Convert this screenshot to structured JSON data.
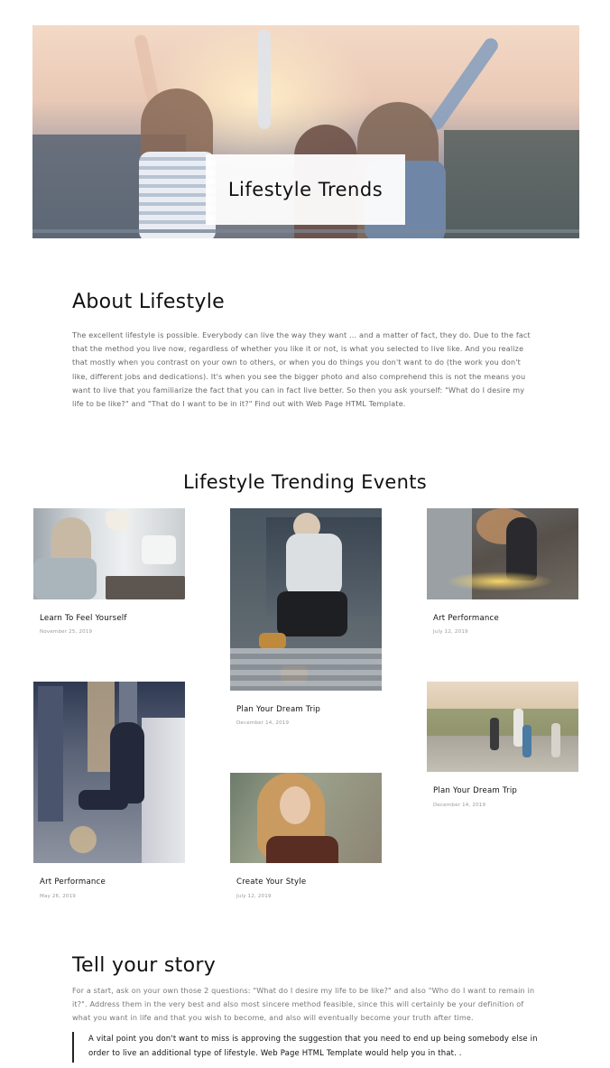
{
  "hero": {
    "title": "Lifestyle Trends"
  },
  "about": {
    "heading": "About Lifestyle",
    "body": "The excellent lifestyle is possible. Everybody can live the way they want ... and a matter of fact, they do. Due to the fact that the method you live now, regardless of whether you like it or not, is what you selected to live like. And you realize that mostly when you contrast on your own to others, or when you do things you don't want to do (the work you don't like, different jobs and dedications). It's when you see the bigger photo and also comprehend this is not the means you want to live that you familiarize the fact that you can in fact live better. So then you ask yourself: \"What do I desire my life to be like?\" and \"That do I want to be in it?\" Find out with Web Page HTML Template."
  },
  "events": {
    "heading": "Lifestyle Trending Events",
    "items": [
      {
        "title": "Learn To Feel Yourself",
        "date": "November 25, 2019",
        "image": "woman-sitting-on-sofa-photo"
      },
      {
        "title": "Plan Your Dream Trip",
        "date": "December 14, 2019",
        "image": "man-sitting-on-stairs-photo"
      },
      {
        "title": "Art Performance",
        "date": "July 12, 2019",
        "image": "woman-with-sparkler-lights-photo"
      },
      {
        "title": "Art Performance",
        "date": "May 26, 2019",
        "image": "man-on-rooftop-city-night-photo"
      },
      {
        "title": "Create Your Style",
        "date": "July 12, 2019",
        "image": "woman-curly-hair-photo"
      },
      {
        "title": "Plan Your Dream Trip",
        "date": "December 14, 2019",
        "image": "friends-walking-on-road-photo"
      }
    ]
  },
  "story": {
    "heading": "Tell your story",
    "body": "For a start, ask on your own those 2 questions: \"What do I desire my life to be like?\" and also \"Who do I want to remain in it?\". Address them in the very best and also most sincere method feasible, since this will certainly be your definition of what you want in life and that you wish to become, and also will eventually become your truth after time.",
    "quote": "A vital point you don't want to miss is approving the suggestion that you need to end up being somebody else in order to live an additional type of lifestyle. Web Page HTML Template would help you in that. ."
  }
}
